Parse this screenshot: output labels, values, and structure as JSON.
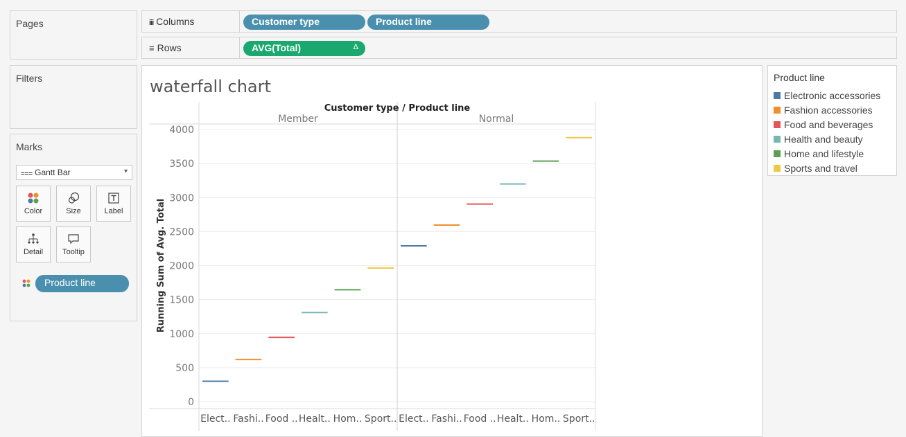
{
  "pages_panel": {
    "title": "Pages"
  },
  "filters_panel": {
    "title": "Filters"
  },
  "marks_panel": {
    "title": "Marks",
    "mark_type": "Gantt Bar",
    "mark_type_icon": "gantt-icon",
    "buttons": [
      {
        "label": "Color",
        "icon": "color-icon"
      },
      {
        "label": "Size",
        "icon": "size-icon"
      },
      {
        "label": "Label",
        "icon": "label-icon"
      },
      {
        "label": "Detail",
        "icon": "detail-icon"
      },
      {
        "label": "Tooltip",
        "icon": "tooltip-icon"
      }
    ],
    "fields": [
      {
        "label": "Product line",
        "encoding": "color"
      }
    ]
  },
  "columns_shelf": {
    "label": "Columns",
    "icon": "columns-icon",
    "pills": [
      "Customer type",
      "Product line"
    ]
  },
  "rows_shelf": {
    "label": "Rows",
    "icon": "rows-icon",
    "pills": [
      {
        "label": "AVG(Total)",
        "delta": "Δ"
      }
    ]
  },
  "colors": {
    "pill_blue": "#4a8fae",
    "pill_green": "#1aa86f"
  },
  "legend": {
    "title": "Product line",
    "items": [
      {
        "label": "Electronic accessories",
        "color": "#4e79a7"
      },
      {
        "label": "Fashion accessories",
        "color": "#f28e2b"
      },
      {
        "label": "Food and beverages",
        "color": "#e15759"
      },
      {
        "label": "Health and beauty",
        "color": "#76b7b2"
      },
      {
        "label": "Home and lifestyle",
        "color": "#59a14f"
      },
      {
        "label": "Sports and travel",
        "color": "#edc948"
      }
    ]
  },
  "chart_data": {
    "type": "waterfall",
    "title": "waterfall chart",
    "header": "Customer type / Product line",
    "ylabel": "Running Sum of Avg. Total",
    "ylim": [
      0,
      4000
    ],
    "yticks": [
      0,
      500,
      1000,
      1500,
      2000,
      2500,
      3000,
      3500,
      4000
    ],
    "groups": [
      {
        "name": "Member",
        "categories": [
          "Elect..",
          "Fashi..",
          "Food ..",
          "Healt..",
          "Hom..",
          "Sport.."
        ],
        "values": [
          300,
          620,
          945,
          1310,
          1645,
          1965
        ]
      },
      {
        "name": "Normal",
        "categories": [
          "Elect..",
          "Fashi..",
          "Food ..",
          "Healt..",
          "Hom..",
          "Sport.."
        ],
        "values": [
          2290,
          2595,
          2905,
          3200,
          3535,
          3880
        ]
      }
    ]
  }
}
